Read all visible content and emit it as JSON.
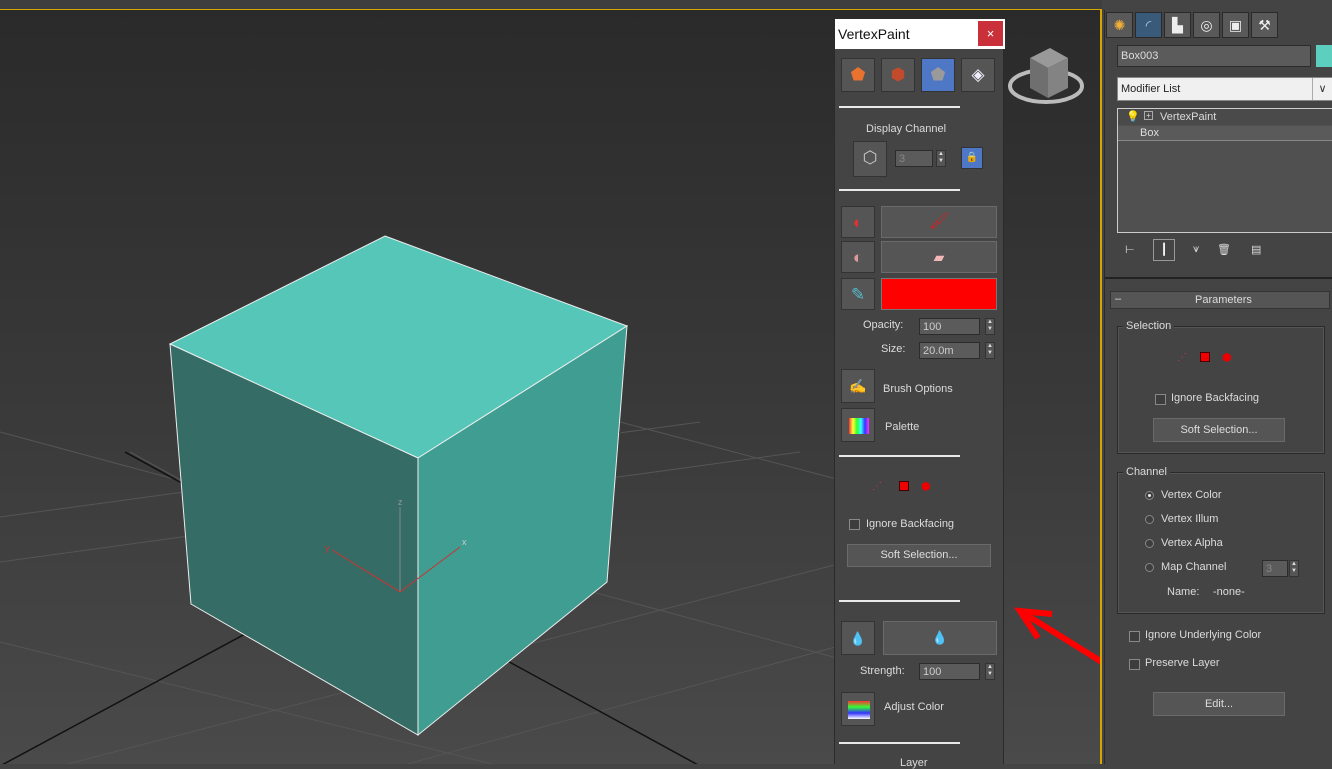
{
  "viewport": {
    "axis_x": "x",
    "axis_y": "y",
    "axis_z": "z"
  },
  "vertex_paint": {
    "title": "VertexPaint",
    "close_glyph": "×",
    "display_channel_label": "Display Channel",
    "display_channel_value": "3",
    "opacity_label": "Opacity:",
    "opacity_value": "100",
    "size_label": "Size:",
    "size_value": "20.0m",
    "paint_color": "#ff0000",
    "brush_options_label": "Brush Options",
    "palette_label": "Palette",
    "ignore_backfacing_label": "Ignore Backfacing",
    "soft_selection_label": "Soft Selection...",
    "strength_label": "Strength:",
    "strength_value": "100",
    "adjust_color_label": "Adjust Color",
    "layer_label": "Layer"
  },
  "command_panel": {
    "object_name": "Box003",
    "object_color": "#5dcfbe",
    "modifier_list_label": "Modifier List",
    "stack": [
      "VertexPaint",
      "Box"
    ],
    "rollout_minus": "–",
    "parameters_title": "Parameters",
    "selection_group": "Selection",
    "ignore_backfacing_label": "Ignore Backfacing",
    "soft_selection_label": "Soft Selection...",
    "channel_group": "Channel",
    "channel_options": [
      "Vertex Color",
      "Vertex Illum",
      "Vertex Alpha",
      "Map Channel"
    ],
    "channel_selected": "Vertex Color",
    "map_channel_value": "3",
    "name_label": "Name:",
    "name_value": "-none-",
    "ignore_underlying_label": "Ignore Underlying Color",
    "preserve_layer_label": "Preserve Layer",
    "edit_label": "Edit..."
  },
  "colors": {
    "accent_blue": "#4e78c6",
    "viewport_border": "#d6a500",
    "arrow": "#ff0000"
  }
}
